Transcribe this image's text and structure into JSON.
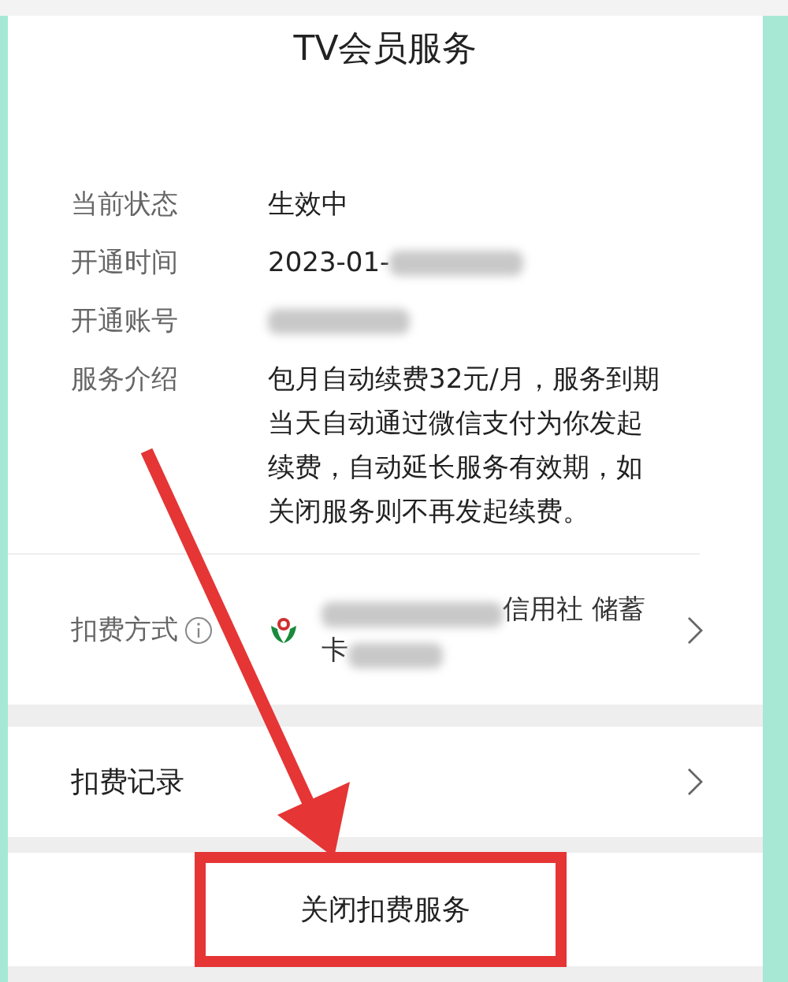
{
  "title": "TV会员服务",
  "details": [
    {
      "label": "当前状态",
      "kind": "text",
      "value": "生效中"
    },
    {
      "label": "开通时间",
      "kind": "partly_redacted",
      "value": "2023-01-"
    },
    {
      "label": "开通账号",
      "kind": "redacted"
    },
    {
      "label": "服务介绍",
      "kind": "text",
      "value": "包月自动续费32元/月，服务到期当天自动通过微信支付为你发起续费，自动延长服务有效期，如关闭服务则不再发起续费。"
    }
  ],
  "payment": {
    "label": "扣费方式",
    "line_1": "信用社 储蓄",
    "line_2": "卡"
  },
  "records": {
    "label": "扣费记录"
  },
  "close_button": "关闭扣费服务"
}
